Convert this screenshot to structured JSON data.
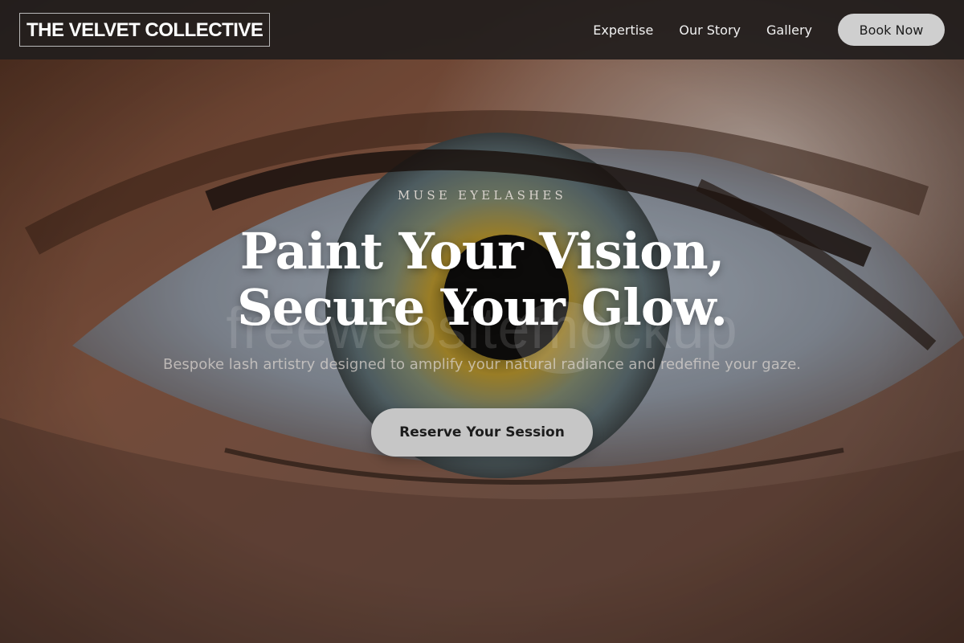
{
  "brand": {
    "name": "THE VELVET COLLECTIVE"
  },
  "nav": {
    "links": [
      {
        "label": "Expertise"
      },
      {
        "label": "Our Story"
      },
      {
        "label": "Gallery"
      }
    ],
    "cta_label": "Book Now"
  },
  "hero": {
    "eyebrow": "MUSE EYELASHES",
    "headline_line1": "Paint Your Vision,",
    "headline_line2": "Secure Your Glow.",
    "subhead": "Bespoke lash artistry designed to amplify your natural radiance and redefine your gaze.",
    "cta_label": "Reserve Your Session",
    "background_image": "close-up-eye-photo"
  },
  "watermark": {
    "text": "freewebsitemockup"
  },
  "colors": {
    "navbar_bg": "#221e1d",
    "button_bg": "#cfcfcf",
    "headline": "#ffffff"
  }
}
